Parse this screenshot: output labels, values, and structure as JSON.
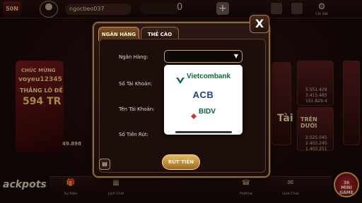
{
  "header": {
    "logo": "50N",
    "username": "ngocbeo037",
    "coins": "0",
    "plus": "+",
    "settings_label": "Cài đặt"
  },
  "promo": {
    "line1": "CHÚC MỪNG",
    "line2": "voyeu12345",
    "line3": "THẮNG LÔ ĐỀ",
    "line4": "594 TR",
    "line5": "49.898"
  },
  "tiles": {
    "tai_label": "Tài",
    "tren_duoi": "TRÊN DƯỚI",
    "stats": [
      "5.551.429",
      "3.415.485",
      "151.829.4"
    ],
    "stats2": [
      "2.025.045",
      "2.403.245",
      "1.403.251"
    ]
  },
  "nav": {
    "items": [
      "Sự Kiện",
      "Lịch Chơi",
      "Hotline",
      "Live Chat"
    ]
  },
  "jackpots": "ackpots",
  "minigame": {
    "top": "36",
    "label": "MINI GAME"
  },
  "modal": {
    "tabs": [
      "NGÂN HÀNG",
      "THẺ CÀO"
    ],
    "close": "X",
    "labels": {
      "bank": "Ngân Hàng:",
      "account_number": "Số Tài Khoản:",
      "account_name": "Tên Tài Khoản:",
      "amount": "Số Tiền Rút:"
    },
    "select_arrow": "▼",
    "banks": [
      "Vietcombank",
      "ACB",
      "BIDV"
    ],
    "withdraw_button": "RÚT TIỀN"
  },
  "colors": {
    "accent_gold": "#c9a35a",
    "vietcombank_green": "#0a6b3a",
    "acb_blue": "#1c3f8e"
  }
}
